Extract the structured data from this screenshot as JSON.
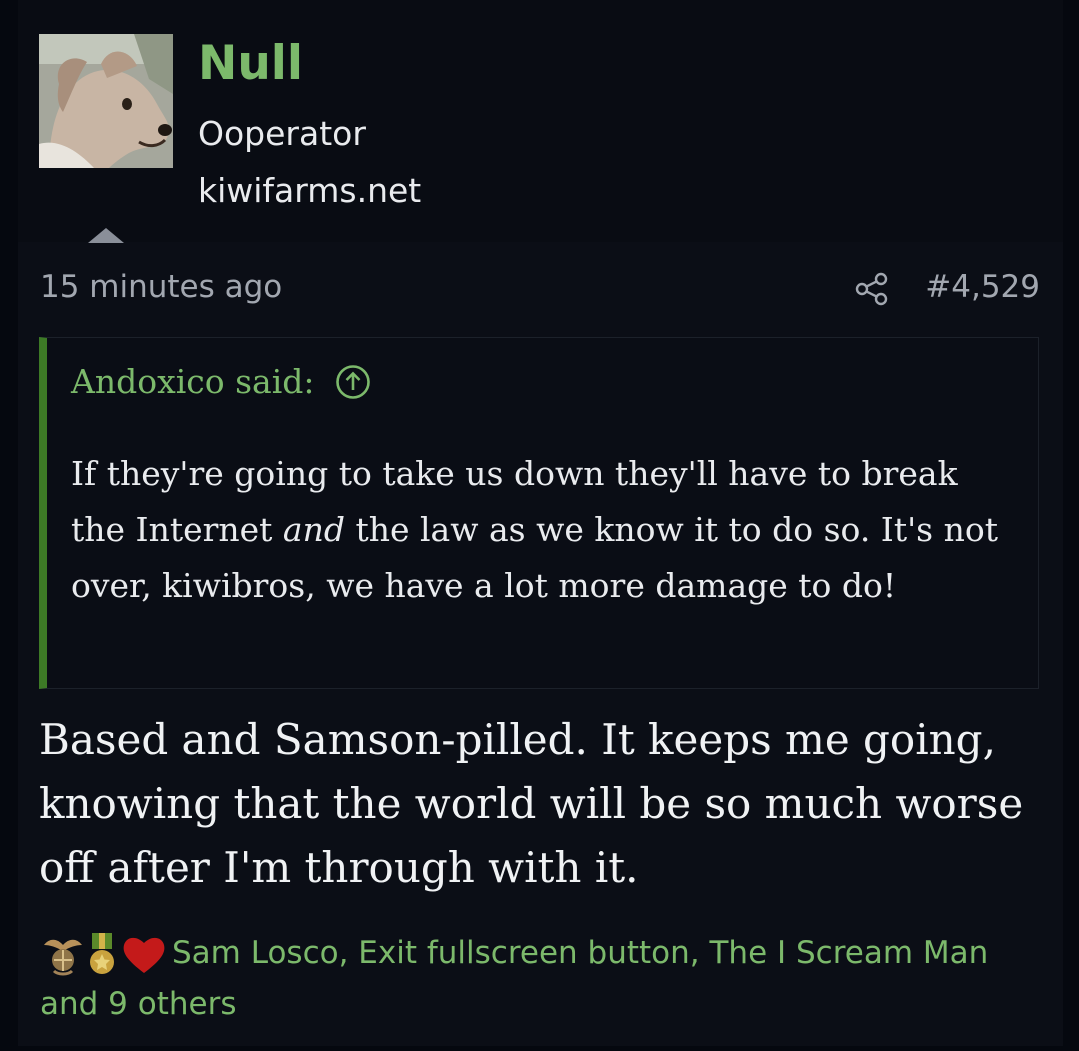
{
  "user": {
    "name": "Null",
    "title": "Ooperator",
    "site": "kiwifarms.net",
    "avatar_icon": "dog-avatar"
  },
  "post": {
    "time": "15 minutes ago",
    "number": "#4,529",
    "share_icon": "share-icon"
  },
  "quote": {
    "author": "Andoxico said:",
    "text_before": "If they're going to take us down they'll have to break the Internet ",
    "text_emphasis": "and",
    "text_after": " the law as we know it to do so. It's not over, kiwibros, we have a lot more damage to do!"
  },
  "message": "Based and Samson-pilled. It keeps me going, knowing that the world will be so much worse off after I'm through with it.",
  "reactions": {
    "icons": [
      "eagle-globe-anchor-icon",
      "medal-icon",
      "heart-icon"
    ],
    "names": "Sam Losco, Exit fullscreen button, The I Scream Man and 9 others"
  },
  "colors": {
    "background": "#0b0e16",
    "accent_green": "#7cb96b",
    "quote_bar": "#3d7a26",
    "text": "#e9ebee",
    "muted_text": "#a2a7b0"
  }
}
